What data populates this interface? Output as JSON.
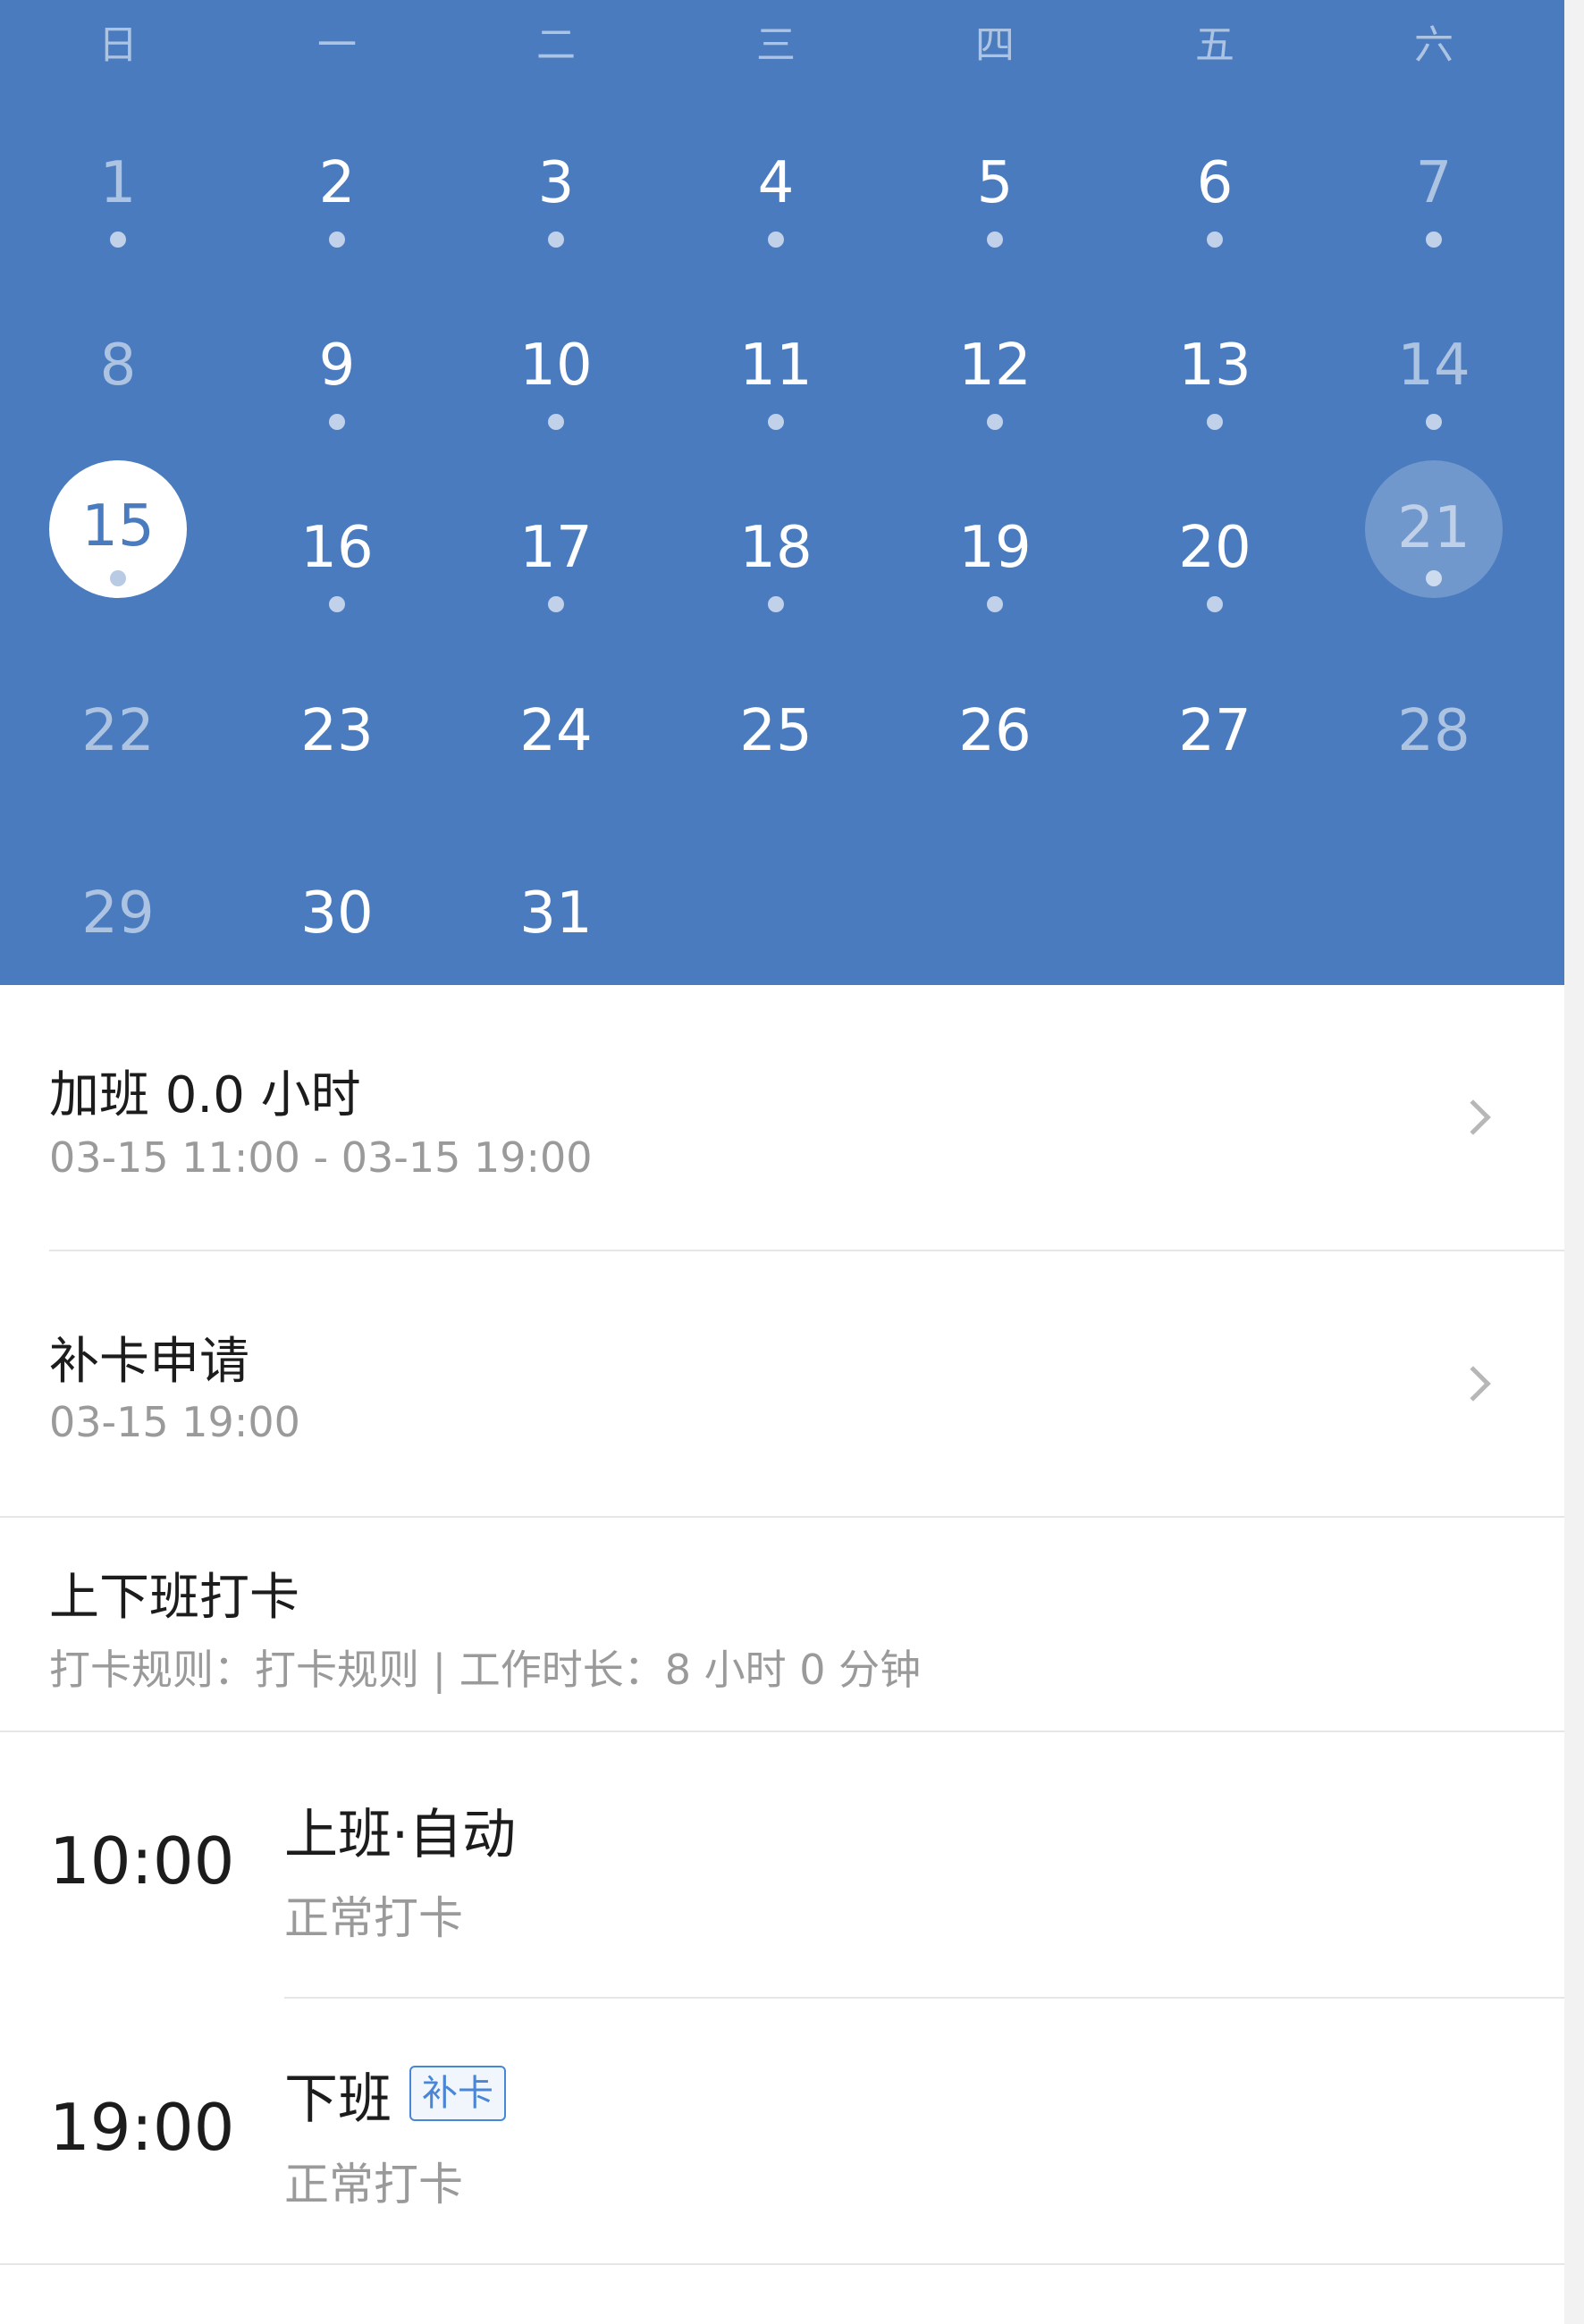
{
  "calendar": {
    "weekdays": [
      "日",
      "一",
      "二",
      "三",
      "四",
      "五",
      "六"
    ],
    "weeks": [
      [
        "1",
        "2",
        "3",
        "4",
        "5",
        "6",
        "7"
      ],
      [
        "8",
        "9",
        "10",
        "11",
        "12",
        "13",
        "14"
      ],
      [
        "15",
        "16",
        "17",
        "18",
        "19",
        "20",
        "21"
      ],
      [
        "22",
        "23",
        "24",
        "25",
        "26",
        "27",
        "28"
      ],
      [
        "29",
        "30",
        "31"
      ]
    ],
    "selected_day": "15",
    "today": "21"
  },
  "records": [
    {
      "title": "加班 0.0 小时",
      "subtitle": "03-15 11:00 - 03-15 19:00"
    },
    {
      "title": "补卡申请",
      "subtitle": "03-15 19:00"
    }
  ],
  "attendance": {
    "title": "上下班打卡",
    "rule": "打卡规则：打卡规则 | 工作时长：8 小时 0 分钟"
  },
  "punches": [
    {
      "time": "10:00",
      "title": "上班·自动",
      "status": "正常打卡"
    },
    {
      "time": "19:00",
      "title": "下班",
      "tag": "补卡",
      "status": "正常打卡"
    }
  ],
  "colors": {
    "calendar_bg": "#4a7bbf",
    "accent": "#4a86d6"
  }
}
